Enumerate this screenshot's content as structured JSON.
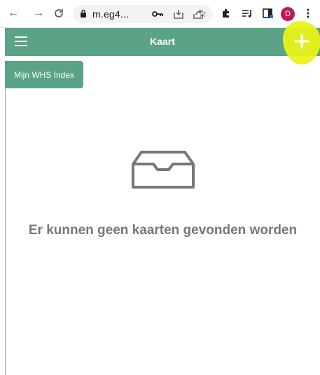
{
  "browser": {
    "url": "m.eg4...",
    "avatar_letter": "D",
    "icons": [
      "back-icon",
      "forward-icon",
      "reload-icon",
      "lock-icon",
      "key-icon",
      "install-icon",
      "share-icon",
      "bookmark-star-icon",
      "extensions-icon",
      "reading-list-icon",
      "side-panel-icon",
      "menu-dots-icon"
    ]
  },
  "appbar": {
    "title": "Kaart"
  },
  "actions": {
    "whs_index_label": "Mijn WHS Index"
  },
  "empty_state": {
    "message": "Er kunnen geen kaarten gevonden worden"
  },
  "colors": {
    "brand_green": "#5aa386",
    "highlight_yellow": "#e8f21a",
    "avatar": "#c2185b"
  }
}
